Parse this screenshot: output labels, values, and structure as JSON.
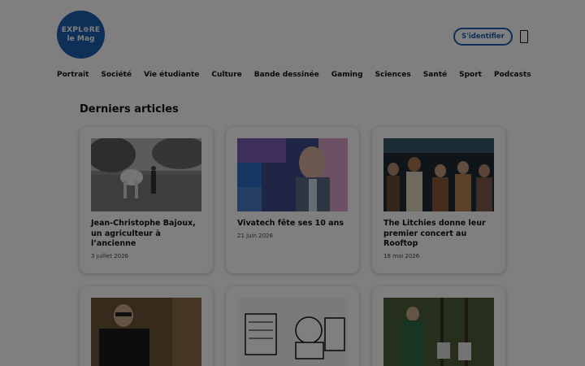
{
  "header": {
    "logo_line1": "EXPL⊕RE",
    "logo_line2": "le Mag",
    "login_label": "S'identifier",
    "menu_icon": "menu-icon"
  },
  "nav": {
    "items": [
      "Portrait",
      "Société",
      "Vie étudiante",
      "Culture",
      "Bande dessinée",
      "Gaming",
      "Sciences",
      "Santé",
      "Sport",
      "Podcasts"
    ]
  },
  "main": {
    "section_title": "Derniers articles",
    "articles": [
      {
        "title": "Jean-Christophe Bajoux, un agriculteur à l’ancienne",
        "date": "3 juillet 2026"
      },
      {
        "title": "Vivatech fête ses 10 ans",
        "date": "21 juin 2026"
      },
      {
        "title": "The Litchies donne leur premier concert au Rooftop",
        "date": "18 mai 2026"
      },
      {
        "title": "",
        "date": ""
      },
      {
        "title": "",
        "date": ""
      },
      {
        "title": "",
        "date": ""
      }
    ]
  },
  "colors": {
    "brand": "#1d5fae",
    "overlay": "rgba(0,0,0,0.5)"
  }
}
